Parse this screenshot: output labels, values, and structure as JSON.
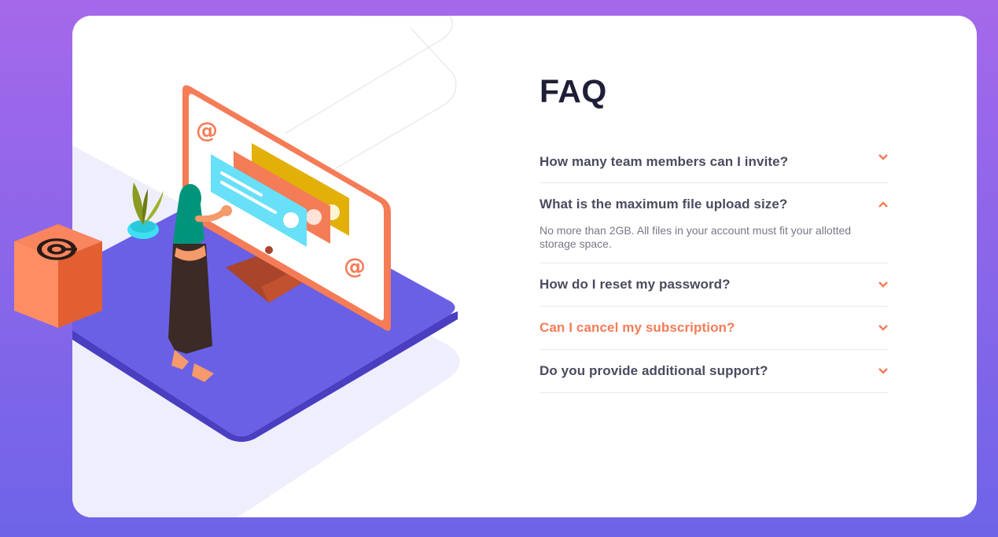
{
  "faq": {
    "title": "FAQ",
    "items": [
      {
        "question": "How many team members can I invite?",
        "expanded": false,
        "hover": false,
        "chevron": "chevron-down-icon"
      },
      {
        "question": "What is the maximum file upload size?",
        "expanded": true,
        "hover": false,
        "chevron": "chevron-up-icon",
        "answer": "No more than 2GB. All files in your account must fit your allotted storage space."
      },
      {
        "question": "How do I reset my password?",
        "expanded": false,
        "hover": false,
        "chevron": "chevron-down-icon"
      },
      {
        "question": "Can I cancel my subscription?",
        "expanded": false,
        "hover": true,
        "chevron": "chevron-down-icon"
      },
      {
        "question": "Do you provide additional support?",
        "expanded": false,
        "hover": false,
        "chevron": "chevron-down-icon"
      }
    ]
  },
  "colors": {
    "background_top": "#a568ea",
    "background_bottom": "#6e64e8",
    "title": "#1e1f36",
    "question": "#4a4b5e",
    "accent": "#f47c57",
    "answer": "#787887",
    "divider": "#e8e8ea"
  }
}
